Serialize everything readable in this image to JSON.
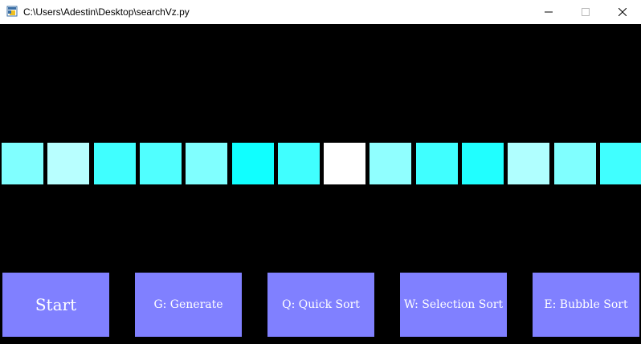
{
  "window": {
    "title": "C:\\Users\\Adestin\\Desktop\\searchVz.py",
    "controls": {
      "minimize_icon": "minimize-icon",
      "maximize_icon": "maximize-icon",
      "close_icon": "close-icon"
    }
  },
  "array": {
    "cells": [
      {
        "color": "#80ffff"
      },
      {
        "color": "#b8ffff"
      },
      {
        "color": "#40ffff"
      },
      {
        "color": "#50ffff"
      },
      {
        "color": "#80ffff"
      },
      {
        "color": "#10ffff"
      },
      {
        "color": "#40ffff"
      },
      {
        "color": "#ffffff"
      },
      {
        "color": "#90ffff"
      },
      {
        "color": "#40ffff"
      },
      {
        "color": "#20ffff"
      },
      {
        "color": "#b0ffff"
      },
      {
        "color": "#80ffff"
      },
      {
        "color": "#40ffff"
      }
    ]
  },
  "buttons": {
    "start": "Start",
    "generate": "G: Generate",
    "quick_sort": "Q: Quick Sort",
    "selection_sort": "W: Selection Sort",
    "bubble_sort": "E: Bubble Sort",
    "color": "#8080ff"
  }
}
